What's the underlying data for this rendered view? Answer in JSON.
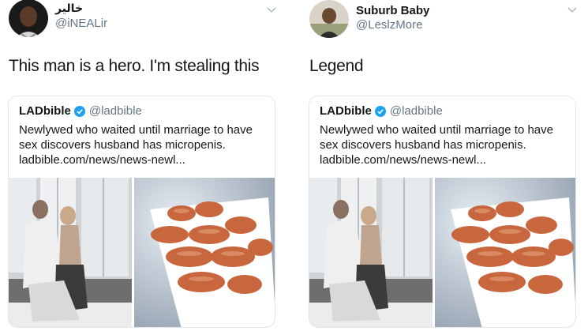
{
  "tweets": [
    {
      "display_name": "خالير",
      "handle": "@iNEALir",
      "text": "This man is a hero. I'm stealing this",
      "quoted": {
        "name": "LADbible",
        "handle": "@ladbible",
        "text": "Newlywed who waited until marriage to have sex discovers husband has micropenis.",
        "link": "ladbible.com/news/news-newl..."
      }
    },
    {
      "display_name": "Suburb Baby",
      "handle": "@LeslzMore",
      "text": "Legend",
      "quoted": {
        "name": "LADbible",
        "handle": "@ladbible",
        "text": "Newlywed who waited until marriage to have sex discovers husband has micropenis.",
        "link": "ladbible.com/news/news-newl..."
      }
    }
  ],
  "icons": {
    "chevron": "chevron-down-icon",
    "verified": "verified-badge-icon"
  },
  "colors": {
    "text": "#14171a",
    "secondary": "#657786",
    "verified": "#1da1f2",
    "border": "#e1e8ed"
  }
}
